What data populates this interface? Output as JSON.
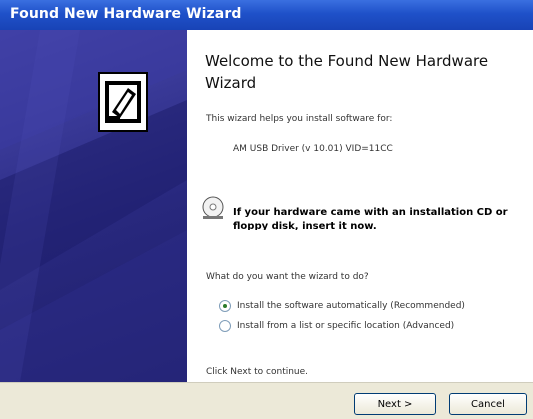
{
  "window": {
    "title": "Found New Hardware Wizard"
  },
  "wizard": {
    "heading": "Welcome to the Found New Hardware Wizard",
    "intro": "This wizard helps you install software for:",
    "device_name": "AM USB Driver (v 10.01) VID=11CC",
    "cd_hint": "If your hardware came with an installation CD or floppy disk, insert it now.",
    "question": "What do you want the wizard to do?",
    "options": [
      {
        "label": "Install the software automatically (Recommended)",
        "selected": true
      },
      {
        "label": "Install from a list or specific location (Advanced)",
        "selected": false
      }
    ],
    "continue_hint": "Click Next to continue."
  },
  "buttons": {
    "next": "Next >",
    "cancel": "Cancel"
  },
  "icons": {
    "hardware": "hardware-wizard-icon",
    "cd": "cd-icon"
  },
  "colors": {
    "titlebar": "#1f51c9",
    "sidepanel": "#28287e",
    "buttonbar": "#ece9d8"
  }
}
